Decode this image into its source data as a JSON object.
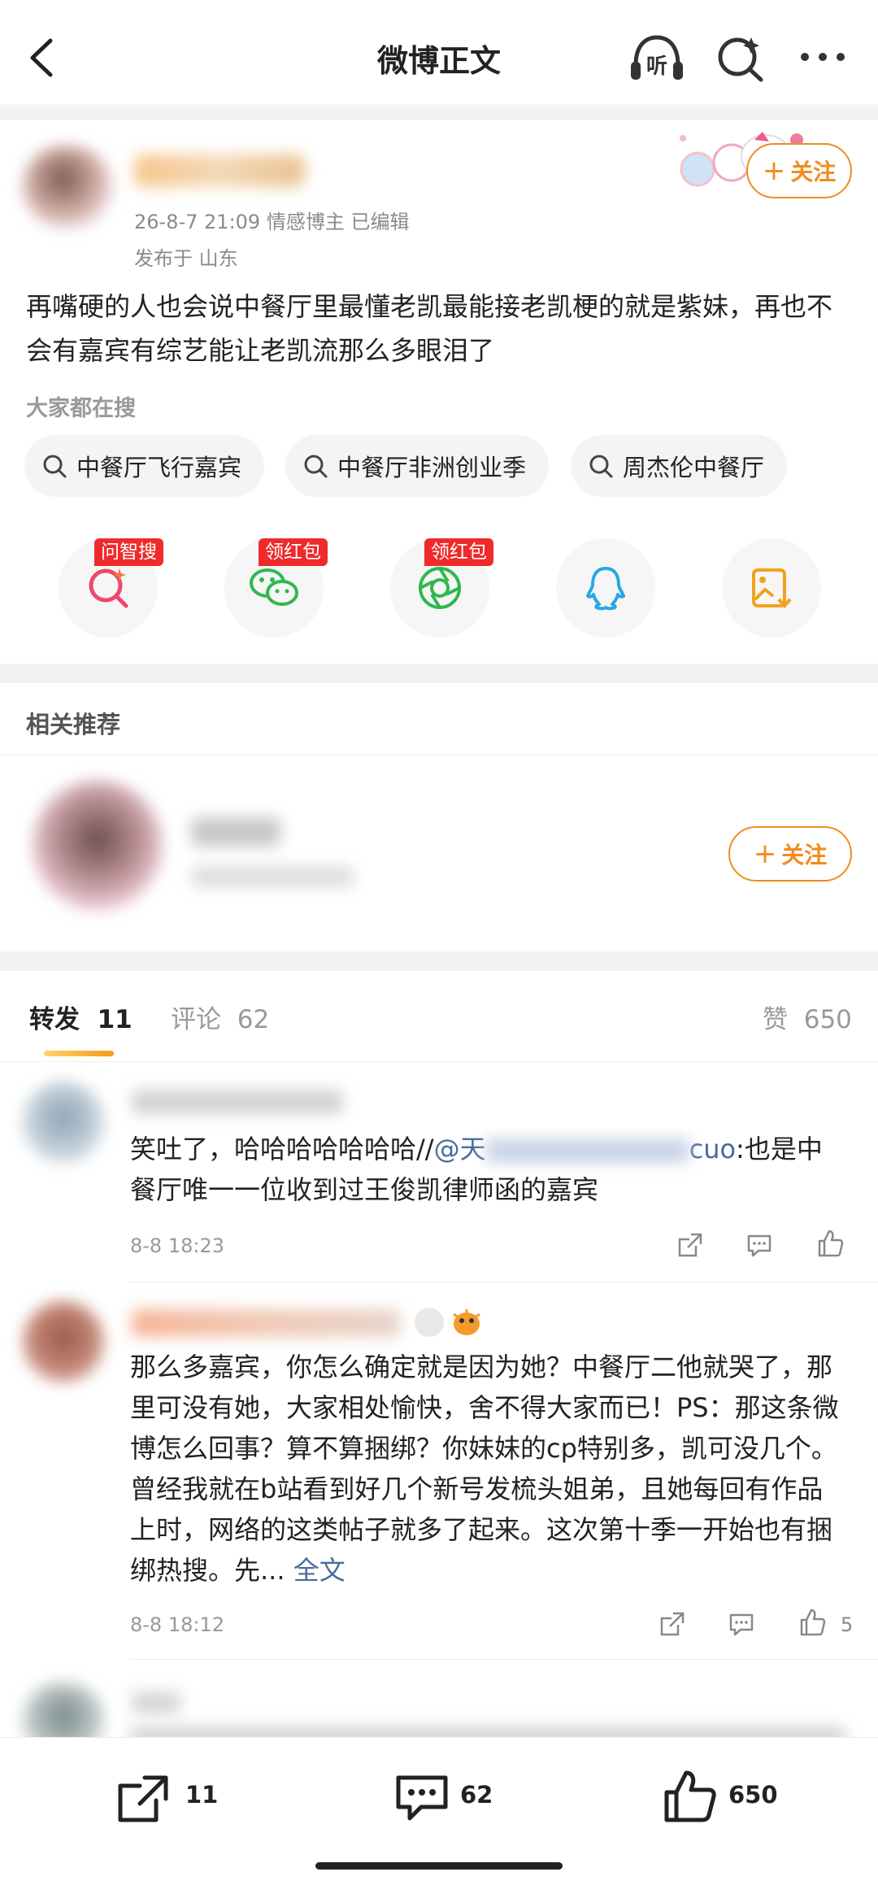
{
  "nav": {
    "title": "微博正文"
  },
  "post": {
    "meta_line": "26-8-7 21:09  情感博主  已编辑",
    "location": "发布于 山东",
    "follow_label": "关注",
    "text": "再嘴硬的人也会说中餐厅里最懂老凯最能接老凯梗的就是紫妹，再也不会有嘉宾有综艺能让老凯流那么多眼泪了"
  },
  "searches": {
    "heading": "大家都在搜",
    "items": [
      "中餐厅飞行嘉宾",
      "中餐厅非洲创业季",
      "周杰伦中餐厅"
    ]
  },
  "share": {
    "tags": [
      "问智搜",
      "领红包",
      "领红包"
    ]
  },
  "related": {
    "heading": "相关推荐",
    "follow_label": "关注"
  },
  "tabs": {
    "repost_label": "转发",
    "repost_count": "11",
    "comment_label": "评论",
    "comment_count": "62",
    "like_label": "赞",
    "like_count": "650"
  },
  "reposts": [
    {
      "text_start": "笑吐了，哈哈哈哈哈哈哈//",
      "mention": "@天",
      "mention_end": "cuo",
      "text_rest": ":也是中餐厅唯一一位收到过王俊凯律师函的嘉宾",
      "time": "8-8 18:23"
    },
    {
      "text": "那么多嘉宾，你怎么确定就是因为她？中餐厅二他就哭了，那里可没有她，大家相处愉快，舍不得大家而已！PS：那这条微博怎么回事？算不算捆绑？你妹妹的cp特别多，凯可没几个。曾经我就在b站看到好几个新号发梳头姐弟，且她每回有作品上时，网络的这类帖子就多了起来。这次第十季一开始也有捆绑热搜。先...",
      "more": "全文",
      "time": "8-8 18:12",
      "likes": "5"
    }
  ],
  "bottom": {
    "repost_count": "11",
    "comment_count": "62",
    "like_count": "650"
  },
  "colors": {
    "accent": "#f08c1e",
    "link": "#4a6b9c",
    "tag_red": "#f02a2a"
  }
}
